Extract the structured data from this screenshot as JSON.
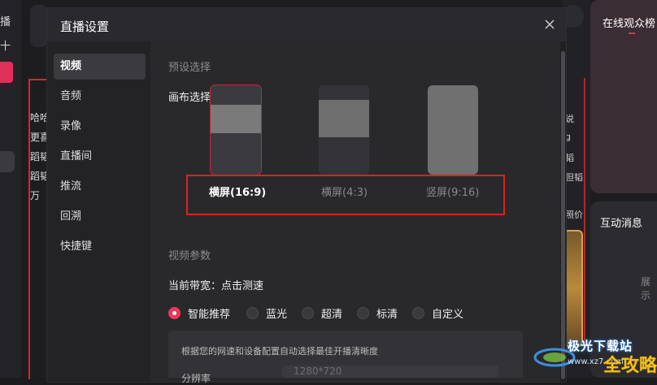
{
  "background": {
    "left_items": [
      "播",
      "十"
    ],
    "stage_lines": [
      "哈哈",
      "更喜",
      "蹈韬",
      "蹈韬",
      "万"
    ],
    "right_panel_title": "在线观众榜",
    "right_panel_title2": "互动消息",
    "right_panel_faint": "展示",
    "mid_lines": [
      "说",
      "g",
      "韬",
      "但韬",
      "照价"
    ]
  },
  "dialog": {
    "title": "直播设置",
    "nav": [
      {
        "label": "视频",
        "active": true
      },
      {
        "label": "音频",
        "active": false
      },
      {
        "label": "录像",
        "active": false
      },
      {
        "label": "直播间",
        "active": false
      },
      {
        "label": "推流",
        "active": false
      },
      {
        "label": "回溯",
        "active": false
      },
      {
        "label": "快捷键",
        "active": false
      }
    ],
    "preset_section": "预设选择",
    "canvas_label": "画布选择",
    "canvas_options": [
      {
        "label": "横屏(16:9)",
        "selected": true
      },
      {
        "label": "横屏(4:3)",
        "selected": false
      },
      {
        "label": "竖屏(9:16)",
        "selected": false
      }
    ],
    "video_params_section": "视频参数",
    "bandwidth_label": "当前带宽：点击测速",
    "quality_options": [
      {
        "label": "智能推荐",
        "checked": true
      },
      {
        "label": "蓝光",
        "checked": false
      },
      {
        "label": "超清",
        "checked": false
      },
      {
        "label": "标清",
        "checked": false
      },
      {
        "label": "自定义",
        "checked": false
      }
    ],
    "info_text": "根据您的网速和设备配置自动选择最佳开播清晰度",
    "resolution_label": "分辨率",
    "resolution_placeholder": "1280*720"
  },
  "watermark": {
    "text": "极光下载站",
    "url": "www.xz7.com",
    "brand": "全攻略"
  },
  "colors": {
    "accent": "#f0365a",
    "highlight_box": "#e02020"
  }
}
